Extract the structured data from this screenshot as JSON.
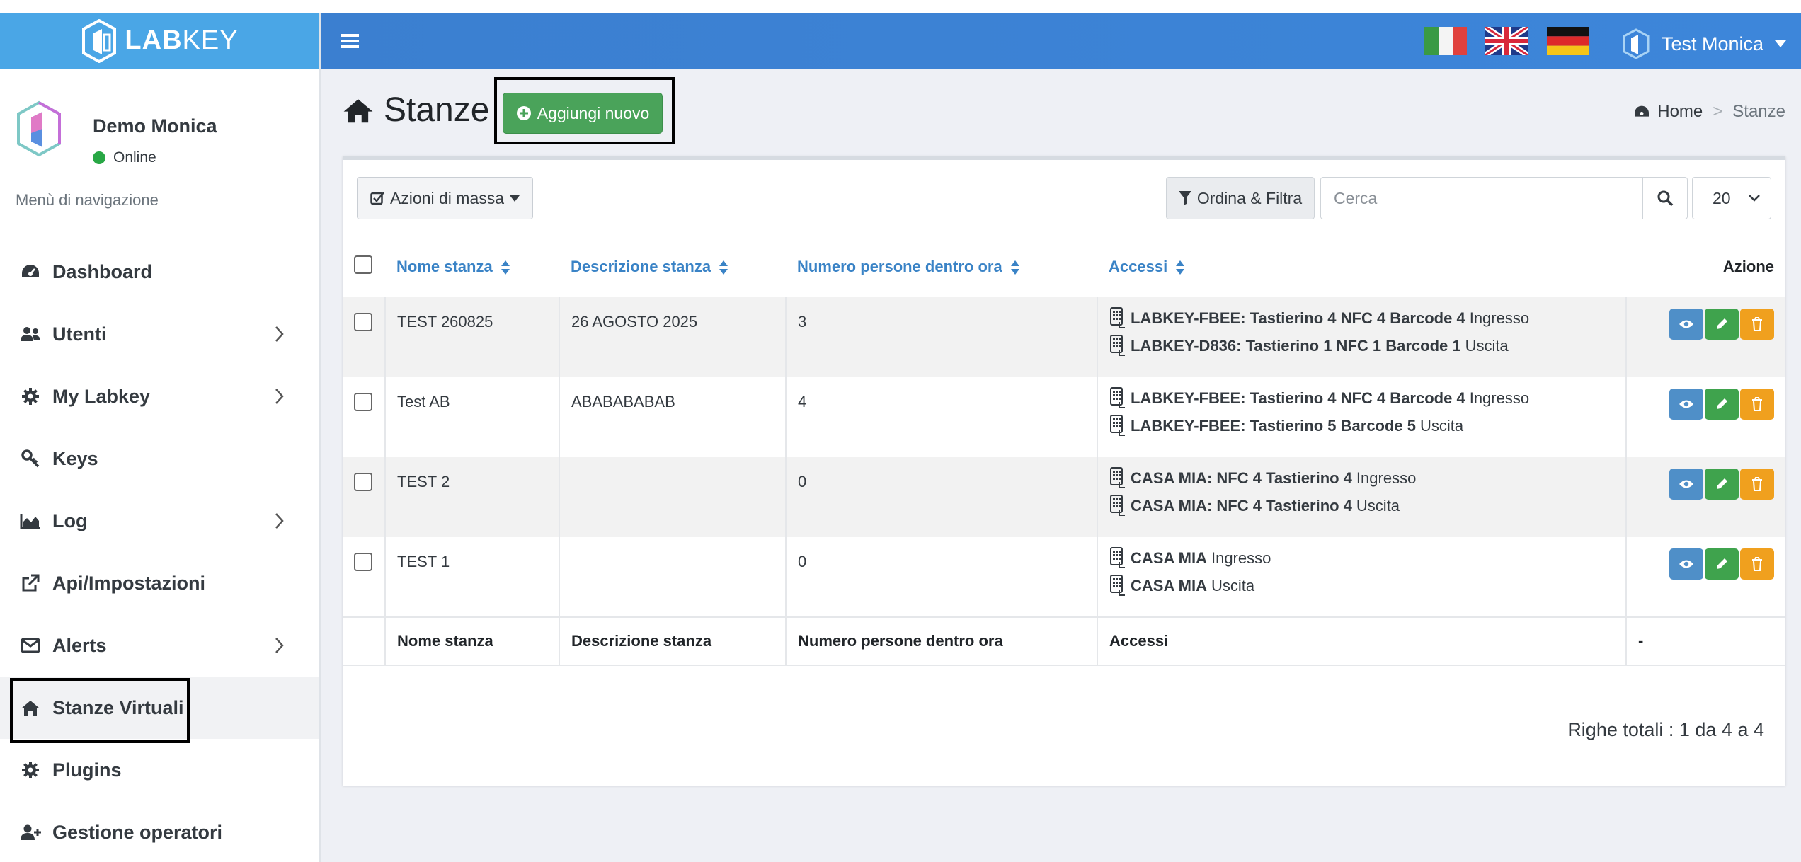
{
  "brand": {
    "name_bold": "LAB",
    "name_light": "KEY"
  },
  "user_panel": {
    "name": "Demo Monica",
    "status": "Online"
  },
  "nav": {
    "header": "Menù di navigazione",
    "items": [
      {
        "label": "Dashboard",
        "icon": "dashboard-icon",
        "has_children": false
      },
      {
        "label": "Utenti",
        "icon": "users-icon",
        "has_children": true
      },
      {
        "label": "My Labkey",
        "icon": "gear-icon",
        "has_children": true
      },
      {
        "label": "Keys",
        "icon": "key-icon",
        "has_children": false
      },
      {
        "label": "Log",
        "icon": "area-chart-icon",
        "has_children": true
      },
      {
        "label": "Api/Impostazioni",
        "icon": "external-link-icon",
        "has_children": false
      },
      {
        "label": "Alerts",
        "icon": "envelope-icon",
        "has_children": true
      },
      {
        "label": "Stanze Virtuali",
        "icon": "home-icon",
        "has_children": false,
        "active": true
      },
      {
        "label": "Plugins",
        "icon": "gear-icon",
        "has_children": false
      },
      {
        "label": "Gestione operatori",
        "icon": "user-plus-icon",
        "has_children": false
      }
    ]
  },
  "topbar": {
    "user_name": "Test Monica",
    "languages": [
      "Italiano",
      "English",
      "Deutsch"
    ]
  },
  "page": {
    "title": "Stanze",
    "add_button": "Aggiungi nuovo",
    "breadcrumb": {
      "home": "Home",
      "separator": ">",
      "current": "Stanze"
    }
  },
  "toolbar": {
    "bulk_actions": "Azioni di massa",
    "sort_filter": "Ordina & Filtra",
    "search_placeholder": "Cerca",
    "page_size": "20"
  },
  "table": {
    "headers": {
      "name": "Nome stanza",
      "description": "Descrizione stanza",
      "people": "Numero persone dentro ora",
      "access": "Accessi",
      "action": "Azione"
    },
    "rows": [
      {
        "name": "TEST 260825",
        "description": "26 AGOSTO 2025",
        "people": "3",
        "access": [
          {
            "device": "LABKEY-FBEE: Tastierino 4 NFC 4 Barcode 4",
            "direction": "Ingresso"
          },
          {
            "device": "LABKEY-D836: Tastierino 1 NFC 1 Barcode 1",
            "direction": "Uscita"
          }
        ]
      },
      {
        "name": "Test AB",
        "description": "ABABABABAB",
        "people": "4",
        "access": [
          {
            "device": "LABKEY-FBEE: Tastierino 4 NFC 4 Barcode 4",
            "direction": "Ingresso"
          },
          {
            "device": "LABKEY-FBEE: Tastierino 5 Barcode 5",
            "direction": "Uscita"
          }
        ]
      },
      {
        "name": "TEST 2",
        "description": "",
        "people": "0",
        "access": [
          {
            "device": "CASA MIA: NFC 4 Tastierino 4",
            "direction": "Ingresso"
          },
          {
            "device": "CASA MIA: NFC 4 Tastierino 4",
            "direction": "Uscita"
          }
        ]
      },
      {
        "name": "TEST 1",
        "description": "",
        "people": "0",
        "access": [
          {
            "device": "CASA MIA",
            "direction": "Ingresso"
          },
          {
            "device": "CASA MIA",
            "direction": "Uscita"
          }
        ]
      }
    ],
    "footer": {
      "name": "Nome stanza",
      "description": "Descrizione stanza",
      "people": "Numero persone dentro ora",
      "access": "Accessi",
      "action": "-"
    }
  },
  "total_rows": "Righe totali : 1 da 4 a 4",
  "colors": {
    "brand": "#4aa6e6",
    "topbar": "#3b7fd0",
    "add_button": "#4aa35a",
    "view": "#4f8fc8",
    "edit": "#3fa34d",
    "delete": "#f0a01e",
    "header_link": "#3a83c6"
  }
}
